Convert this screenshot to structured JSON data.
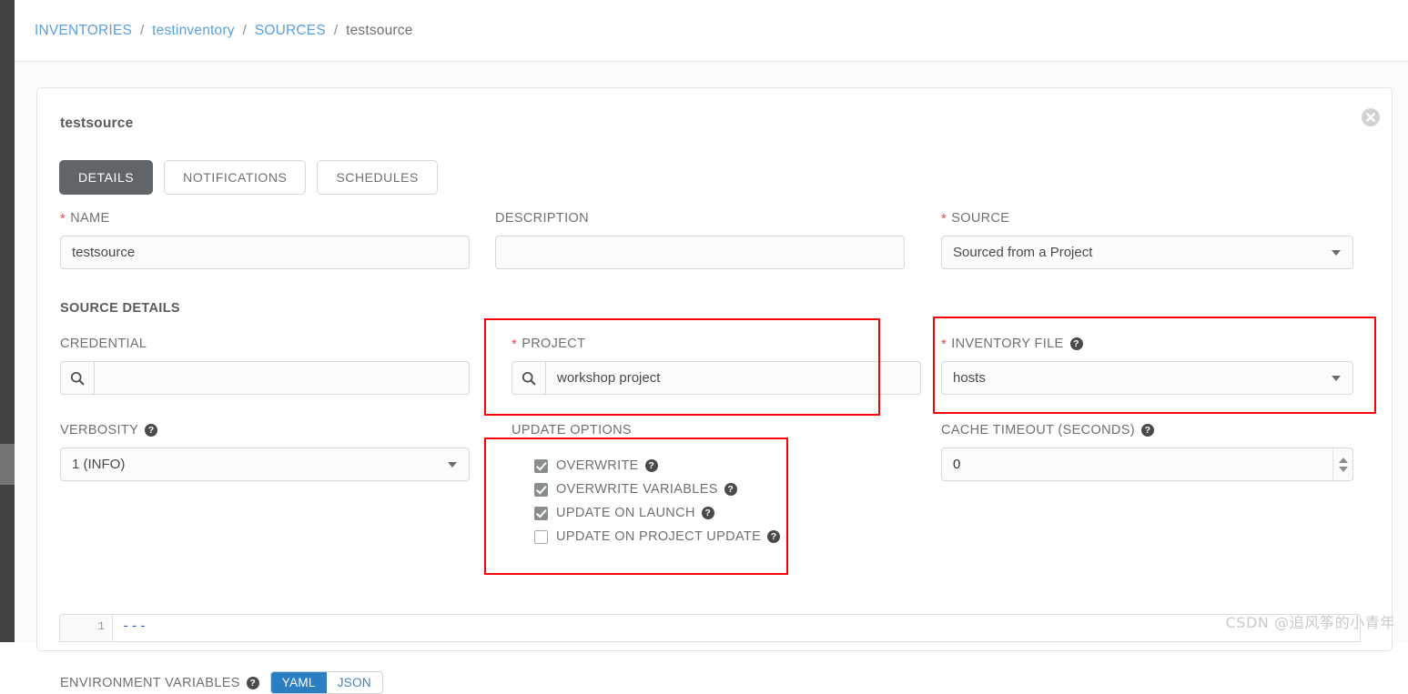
{
  "breadcrumb": {
    "items": [
      {
        "label": "INVENTORIES",
        "current": false
      },
      {
        "label": "testinventory",
        "current": false
      },
      {
        "label": "SOURCES",
        "current": false
      },
      {
        "label": "testsource",
        "current": true
      }
    ],
    "separator": "/"
  },
  "card": {
    "title": "testsource",
    "close_icon": "close-circle-icon"
  },
  "tabs": [
    {
      "label": "DETAILS",
      "active": true
    },
    {
      "label": "NOTIFICATIONS",
      "active": false
    },
    {
      "label": "SCHEDULES",
      "active": false
    }
  ],
  "fields": {
    "name": {
      "label": "NAME",
      "required": true,
      "value": "testsource",
      "placeholder": ""
    },
    "description": {
      "label": "DESCRIPTION",
      "required": false,
      "value": "",
      "placeholder": ""
    },
    "source": {
      "label": "SOURCE",
      "required": true,
      "value": "Sourced from a Project"
    },
    "source_details_heading": "SOURCE DETAILS",
    "credential": {
      "label": "CREDENTIAL",
      "required": false,
      "value": "",
      "placeholder": "",
      "icon": "search-icon"
    },
    "project": {
      "label": "PROJECT",
      "required": true,
      "value": "workshop project",
      "placeholder": "",
      "icon": "search-icon",
      "highlighted": true
    },
    "inventory_file": {
      "label": "INVENTORY FILE",
      "required": true,
      "value": "hosts",
      "help": "?",
      "highlighted": true
    },
    "verbosity": {
      "label": "VERBOSITY",
      "required": false,
      "value": "1 (INFO)",
      "help": "?"
    },
    "update_options": {
      "label": "UPDATE OPTIONS",
      "highlighted": true,
      "options": [
        {
          "label": "OVERWRITE",
          "checked": true,
          "help": "?"
        },
        {
          "label": "OVERWRITE VARIABLES",
          "checked": true,
          "help": "?"
        },
        {
          "label": "UPDATE ON LAUNCH",
          "checked": true,
          "help": "?"
        },
        {
          "label": "UPDATE ON PROJECT UPDATE",
          "checked": false,
          "help": "?"
        }
      ]
    },
    "cache_timeout": {
      "label": "CACHE TIMEOUT (SECONDS)",
      "required": false,
      "value": "0",
      "help": "?"
    },
    "environment_variables": {
      "label": "ENVIRONMENT VARIABLES",
      "help": "?",
      "formats": [
        {
          "label": "YAML",
          "active": true
        },
        {
          "label": "JSON",
          "active": false
        }
      ],
      "editor": {
        "line_number": "1",
        "line_text": "---"
      }
    }
  },
  "watermark": "CSDN @追风筝的小青年",
  "colors": {
    "link": "#5a9fdb",
    "required": "#d9534f",
    "tab_active_bg": "#5f6569",
    "toggle_active_bg": "#2b7ec1",
    "annotation": "#fb0007",
    "rail": "#434343"
  }
}
